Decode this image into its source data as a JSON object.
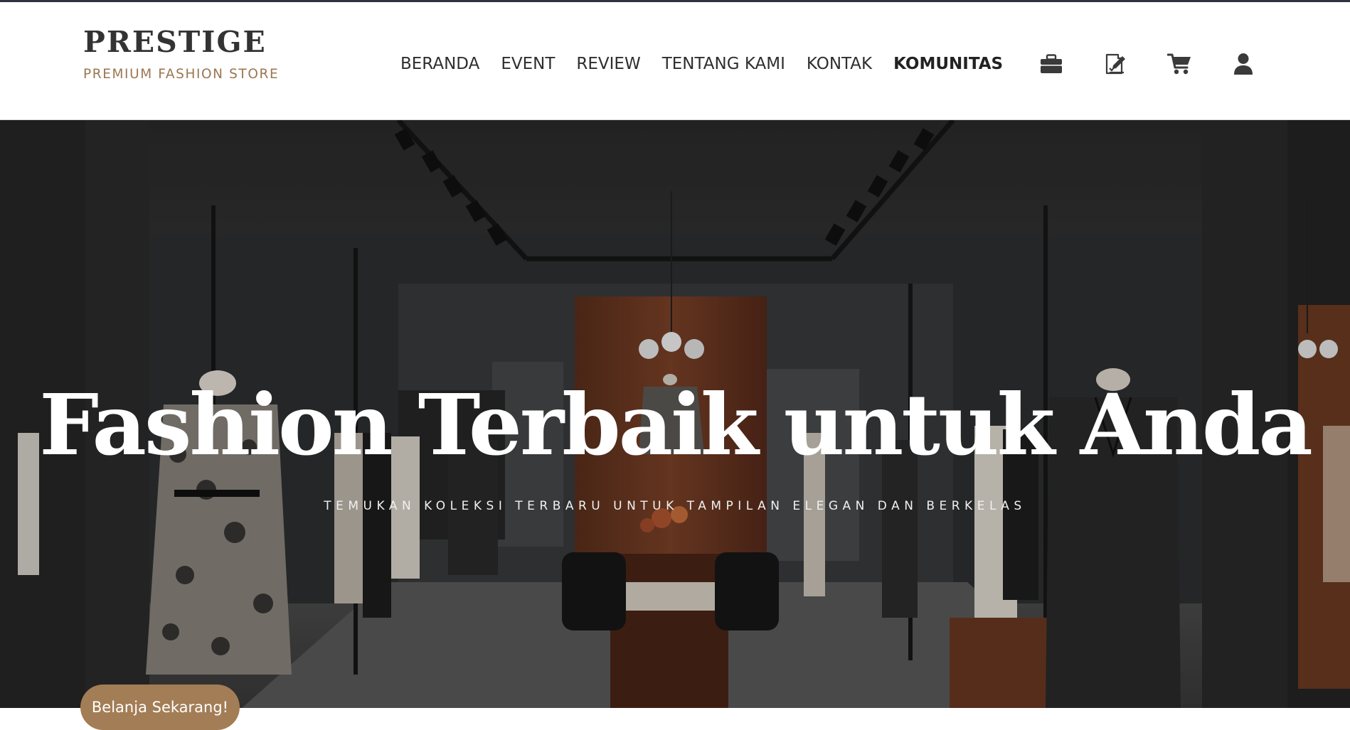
{
  "brand": {
    "name": "PRESTIGE",
    "tagline": "PREMIUM FASHION STORE"
  },
  "nav": {
    "items": [
      {
        "label": "BERANDA",
        "active": false
      },
      {
        "label": "EVENT",
        "active": false
      },
      {
        "label": "REVIEW",
        "active": false
      },
      {
        "label": "TENTANG KAMI",
        "active": false
      },
      {
        "label": "KONTAK",
        "active": false
      },
      {
        "label": "KOMUNITAS",
        "active": true
      }
    ],
    "icons": [
      "briefcase-icon",
      "checklist-edit-icon",
      "cart-icon",
      "user-icon"
    ]
  },
  "hero": {
    "title": "Fashion Terbaik untuk Anda",
    "subtitle": "TEMUKAN KOLEKSI TERBARU UNTUK TAMPILAN ELEGAN DAN BERKELAS",
    "cta_label": "Belanja Sekarang!"
  },
  "colors": {
    "accent": "#a37d55",
    "text_dark": "#2e2e2e",
    "topbar": "#2f3340"
  }
}
